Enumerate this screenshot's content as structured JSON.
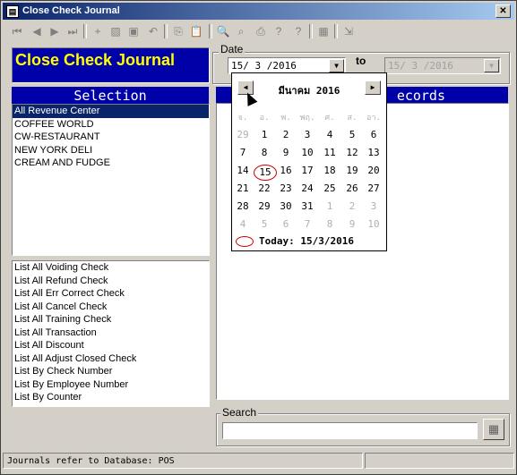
{
  "window": {
    "title": "Close Check Journal",
    "close_glyph": "✕",
    "app_icon": "▤"
  },
  "toolbar": {
    "buttons": [
      {
        "icon": "first-record-icon",
        "glyph": "⏮"
      },
      {
        "icon": "prev-record-icon",
        "glyph": "◀"
      },
      {
        "icon": "next-record-icon",
        "glyph": "▶"
      },
      {
        "icon": "last-record-icon",
        "glyph": "⏭"
      },
      {
        "icon": "add-icon",
        "glyph": "+"
      },
      {
        "icon": "edit-icon",
        "glyph": "▨"
      },
      {
        "icon": "save-icon",
        "glyph": "▣"
      },
      {
        "icon": "undo-icon",
        "glyph": "↶"
      },
      {
        "icon": "copy-icon",
        "glyph": "⎘"
      },
      {
        "icon": "paste-icon",
        "glyph": "📋"
      },
      {
        "icon": "find-icon",
        "glyph": "🔍"
      },
      {
        "icon": "binoculars-icon",
        "glyph": "⌕"
      },
      {
        "icon": "print-icon",
        "glyph": "⎙"
      },
      {
        "icon": "help-pointer-icon",
        "glyph": "?"
      },
      {
        "icon": "help-icon",
        "glyph": "?"
      },
      {
        "icon": "report-icon",
        "glyph": "▦"
      },
      {
        "icon": "exit-icon",
        "glyph": "⇲"
      }
    ]
  },
  "header": {
    "title": "Close Check Journal"
  },
  "date": {
    "group_label": "Date",
    "from_value": "15/ 3 /2016",
    "to_label": "to",
    "to_value": "15/ 3 /2016"
  },
  "selection": {
    "header": "Selection",
    "revenue_centers": [
      "All Revenue Center",
      "COFFEE WORLD",
      "CW-RESTAURANT",
      "NEW YORK DELI",
      "CREAM AND FUDGE"
    ],
    "selected_index": 0,
    "journal_types": [
      "List All Voiding Check",
      "List All Refund Check",
      "List All Err Correct Check",
      "List All Cancel Check",
      "List All Training Check",
      "List All Transaction",
      "List All Discount",
      "List All Adjust Closed Check",
      "List By Check Number",
      "List By Employee Number",
      "List By Counter"
    ]
  },
  "records": {
    "header": "ecords"
  },
  "calendar": {
    "month_label": "มีนาคม 2016",
    "weekdays": [
      "จ.",
      "อ.",
      "พ.",
      "พฤ.",
      "ศ.",
      "ส.",
      "อา."
    ],
    "weeks": [
      [
        "29",
        "1",
        "2",
        "3",
        "4",
        "5",
        "6"
      ],
      [
        "7",
        "8",
        "9",
        "10",
        "11",
        "12",
        "13"
      ],
      [
        "14",
        "15",
        "16",
        "17",
        "18",
        "19",
        "20"
      ],
      [
        "21",
        "22",
        "23",
        "24",
        "25",
        "26",
        "27"
      ],
      [
        "28",
        "29",
        "30",
        "31",
        "1",
        "2",
        "3"
      ],
      [
        "4",
        "5",
        "6",
        "7",
        "8",
        "9",
        "10"
      ]
    ],
    "selected_day": "15",
    "today_label": "Today: 15/3/2016",
    "prev_glyph": "◀",
    "next_glyph": "▶"
  },
  "search": {
    "label": "Search",
    "value": "",
    "button_glyph": "▦"
  },
  "status": {
    "text": "Journals refer to Database: POS"
  }
}
